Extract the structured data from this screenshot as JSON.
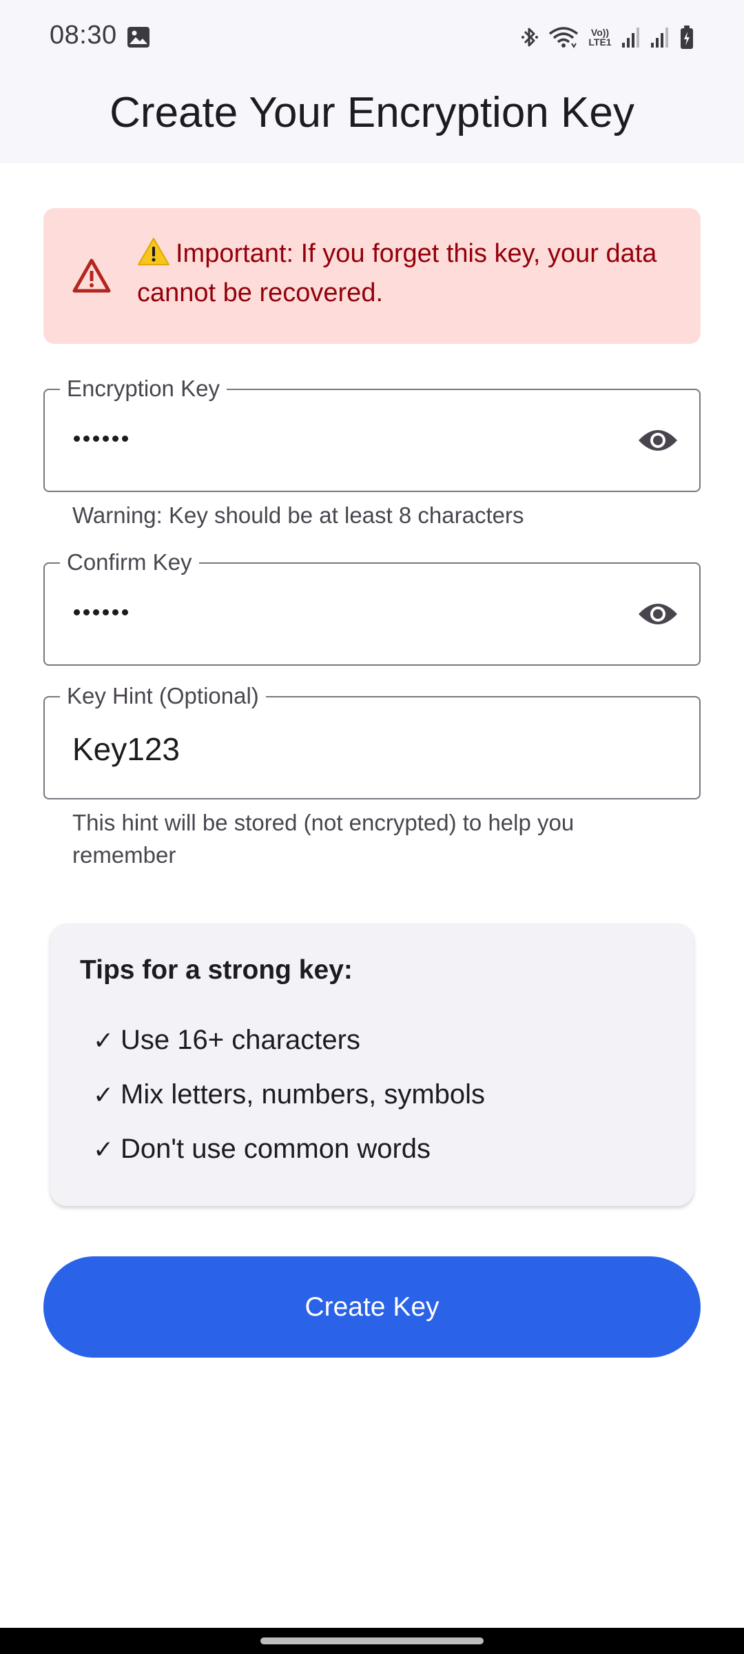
{
  "status_bar": {
    "time": "08:30",
    "icons": [
      "photo-icon",
      "bluetooth-icon",
      "wifi-icon",
      "volte-icon",
      "signal-icon",
      "signal-icon",
      "battery-icon"
    ],
    "volte_top": "Vo))",
    "volte_bottom": "LTE1"
  },
  "app_bar": {
    "title": "Create Your Encryption Key"
  },
  "warning": {
    "icon": "warning-triangle-icon",
    "text": "Important: If you forget this key, your data cannot be recovered.",
    "color": "#93000a",
    "background": "#fddcda"
  },
  "fields": {
    "encryption_key": {
      "label": "Encryption Key",
      "masked_length": 6,
      "helper": "Warning: Key should be at least 8 characters",
      "icon": "eye-icon"
    },
    "confirm_key": {
      "label": "Confirm Key",
      "masked_length": 6,
      "icon": "eye-icon"
    },
    "key_hint": {
      "label": "Key Hint (Optional)",
      "value": "Key123",
      "helper": "This hint will be stored (not encrypted) to help you remember"
    }
  },
  "tips": {
    "title": "Tips for a strong key:",
    "check_glyph": "✓",
    "items": [
      "Use 16+ characters",
      "Mix letters, numbers, symbols",
      "Don't use common words"
    ]
  },
  "actions": {
    "create_label": "Create Key",
    "accent": "#2b63e8"
  }
}
